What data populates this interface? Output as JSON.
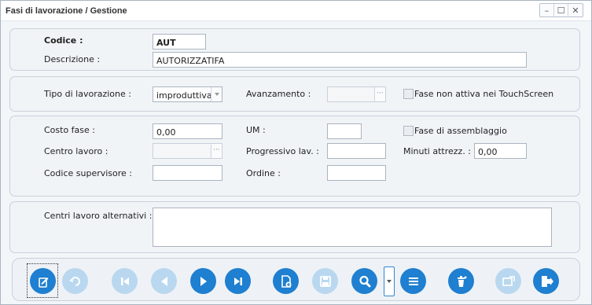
{
  "window": {
    "title": "Fasi di lavorazione / Gestione",
    "controls": {
      "minimize": "–",
      "maximize": "☐",
      "close": "✕"
    }
  },
  "header": {
    "codice_label": "Codice :",
    "codice_value": "AUT",
    "descrizione_label": "Descrizione :",
    "descrizione_value": "AUTORIZZATIFA"
  },
  "tipo": {
    "tipo_label": "Tipo di lavorazione :",
    "tipo_value": "improduttiva",
    "avanzamento_label": "Avanzamento :",
    "avanzamento_value": "",
    "fase_non_attiva_label": "Fase non attiva nei TouchScreen",
    "fase_non_attiva_checked": false
  },
  "costi": {
    "costo_fase_label": "Costo fase :",
    "costo_fase_value": "0,00",
    "um_label": "UM :",
    "um_value": "",
    "fase_assemblaggio_label": "Fase di assemblaggio",
    "fase_assemblaggio_checked": false,
    "centro_lavoro_label": "Centro lavoro :",
    "centro_lavoro_value": "",
    "progressivo_label": "Progressivo lav. :",
    "progressivo_value": "",
    "minuti_label": "Minuti attrezz. :",
    "minuti_value": "0,00",
    "supervisore_label": "Codice supervisore :",
    "supervisore_value": "",
    "ordine_label": "Ordine :",
    "ordine_value": ""
  },
  "alternativi": {
    "label": "Centri lavoro alternativi :",
    "value": ""
  },
  "toolbar": {
    "buttons": [
      {
        "name": "edit",
        "icon": "edit-document-icon",
        "enabled": true
      },
      {
        "name": "undo",
        "icon": "undo-icon",
        "enabled": false
      },
      {
        "name": "first",
        "icon": "first-record-icon",
        "enabled": false
      },
      {
        "name": "previous",
        "icon": "previous-record-icon",
        "enabled": false
      },
      {
        "name": "next",
        "icon": "next-record-icon",
        "enabled": true
      },
      {
        "name": "last",
        "icon": "last-record-icon",
        "enabled": true
      },
      {
        "name": "new",
        "icon": "new-document-icon",
        "enabled": true
      },
      {
        "name": "save",
        "icon": "save-icon",
        "enabled": false
      },
      {
        "name": "search",
        "icon": "search-icon",
        "enabled": true
      },
      {
        "name": "list",
        "icon": "list-icon",
        "enabled": true
      },
      {
        "name": "delete",
        "icon": "delete-icon",
        "enabled": true
      },
      {
        "name": "export",
        "icon": "export-icon",
        "enabled": false
      },
      {
        "name": "exit",
        "icon": "exit-icon",
        "enabled": true
      }
    ]
  },
  "colors": {
    "accent": "#1f7fd0",
    "disabled_accent": "#b9d8ef",
    "panel_border": "#c9d1da"
  }
}
